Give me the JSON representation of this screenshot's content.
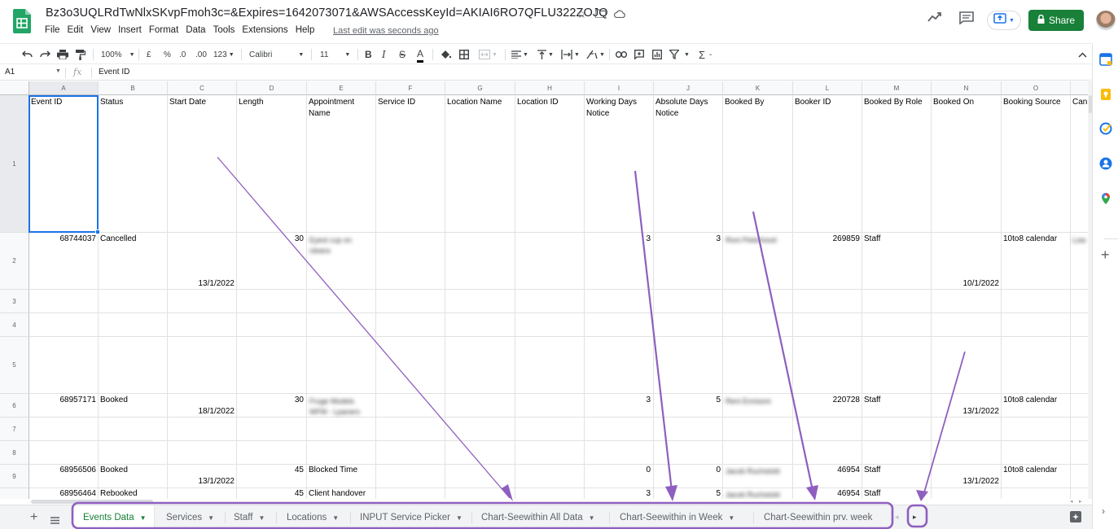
{
  "header": {
    "title": "Bz3o3UQLRdTwNlxSKvpFmoh3c=&Expires=1642073071&AWSAccessKeyId=AKIAI6RO7QFLU322ZOJQ",
    "menu": [
      "File",
      "Edit",
      "View",
      "Insert",
      "Format",
      "Data",
      "Tools",
      "Extensions",
      "Help"
    ],
    "last_edit": "Last edit was seconds ago",
    "share_label": "Share"
  },
  "toolbar": {
    "zoom": "100%",
    "currency": "£",
    "percent": "%",
    "dec_decrease": ".0",
    "dec_increase": ".00",
    "number_format": "123",
    "font": "Calibri",
    "font_size": "11",
    "bold": "B",
    "italic": "I",
    "strike": "S",
    "text_color": "A",
    "sum": "Σ"
  },
  "formula_bar": {
    "cell_ref": "A1",
    "fx": "fx",
    "value": "Event ID"
  },
  "columns": [
    "A",
    "B",
    "C",
    "D",
    "E",
    "F",
    "G",
    "H",
    "I",
    "J",
    "K",
    "L",
    "M",
    "N",
    "O"
  ],
  "rows": [
    "1",
    "2",
    "3",
    "4",
    "5",
    "6",
    "7",
    "8",
    "9"
  ],
  "headers": [
    "Event ID",
    "Status",
    "Start Date",
    "Length",
    "Appointment Name",
    "Service ID",
    "Location Name",
    "Location ID",
    "Working Days Notice",
    "Absolute Days Notice",
    "Booked By",
    "Booker ID",
    "Booked By Role",
    "Booked On",
    "Booking Source",
    "Can"
  ],
  "data_rows": [
    {
      "event_id": "68744037",
      "status": "Cancelled",
      "start_date": "13/1/2022",
      "length": "30",
      "appt": "Eyest cup on cleans",
      "wdn": "3",
      "adn": "3",
      "booked_by": "Roni Peterhood",
      "booker_id": "269859",
      "role": "Staff",
      "booked_on": "10/1/2022",
      "source": "10to8 calendar",
      "extra": "Low"
    },
    {
      "event_id": "68957171",
      "status": "Booked",
      "start_date": "18/1/2022",
      "length": "30",
      "appt": "Fruge Models WFM - Lpaners",
      "wdn": "3",
      "adn": "5",
      "booked_by": "Reni Ennisoni",
      "booker_id": "220728",
      "role": "Staff",
      "booked_on": "13/1/2022",
      "source": "10to8 calendar"
    },
    {
      "event_id": "68956506",
      "status": "Booked",
      "start_date": "13/1/2022",
      "length": "45",
      "appt": "Blocked Time",
      "wdn": "0",
      "adn": "0",
      "booked_by": "Jacob Ruchstold",
      "booker_id": "46954",
      "role": "Staff",
      "booked_on": "13/1/2022",
      "source": "10to8 calendar"
    },
    {
      "event_id": "68956464",
      "status": "Rebooked",
      "length": "45",
      "appt": "Client handover",
      "wdn": "3",
      "adn": "5",
      "booked_by": "Jacob Ruchstold",
      "booker_id": "46954",
      "role": "Staff"
    }
  ],
  "tabs": [
    "Events Data",
    "Services",
    "Staff",
    "Locations",
    "INPUT Service Picker",
    "Chart-Seewithin All Data",
    "Chart-Seewithin in Week",
    "Chart-Seewithin prv. week"
  ],
  "colors": {
    "accent_green": "#188038",
    "annotation_purple": "#8e5fbf",
    "selection_blue": "#1a73e8"
  }
}
